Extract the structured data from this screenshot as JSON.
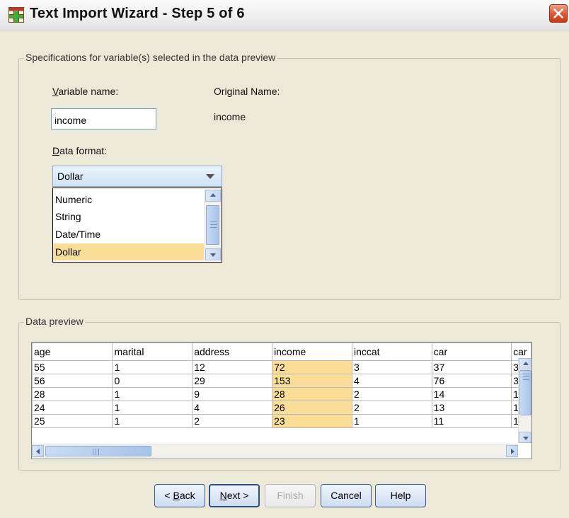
{
  "window": {
    "title": "Text Import Wizard - Step 5 of 6"
  },
  "specs": {
    "legend": "Specifications for variable(s) selected in the data preview",
    "variable_name_label_accel": "V",
    "variable_name_label_rest": "ariable name:",
    "variable_name_value": "income",
    "original_name_label": "Original Name:",
    "original_name_value": "income",
    "data_format_label_accel": "D",
    "data_format_label_rest": "ata format:",
    "data_format_selected": "Dollar",
    "data_format_options": [
      "Numeric",
      "String",
      "Date/Time",
      "Dollar"
    ]
  },
  "preview": {
    "legend": "Data preview",
    "columns": [
      "age",
      "marital",
      "address",
      "income",
      "inccat",
      "car",
      "car"
    ],
    "rows": [
      [
        "55",
        "1",
        "12",
        "72",
        "3",
        "37",
        "3"
      ],
      [
        "56",
        "0",
        "29",
        "153",
        "4",
        "76",
        "3"
      ],
      [
        "28",
        "1",
        "9",
        "28",
        "2",
        "14",
        "1"
      ],
      [
        "24",
        "1",
        "4",
        "26",
        "2",
        "13",
        "1"
      ],
      [
        "25",
        "1",
        "2",
        "23",
        "1",
        "11",
        "1"
      ]
    ],
    "highlighted_column": "income"
  },
  "buttons": {
    "back_pre": "< ",
    "back_accel": "B",
    "back_rest": "ack",
    "next_accel": "N",
    "next_rest": "ext >",
    "finish": "Finish",
    "cancel": "Cancel",
    "help": "Help"
  },
  "colors": {
    "highlight": "#fadd96",
    "close_button": "#e0542f"
  },
  "icons": {
    "app": "spreadsheet-icon",
    "close": "close-icon"
  }
}
